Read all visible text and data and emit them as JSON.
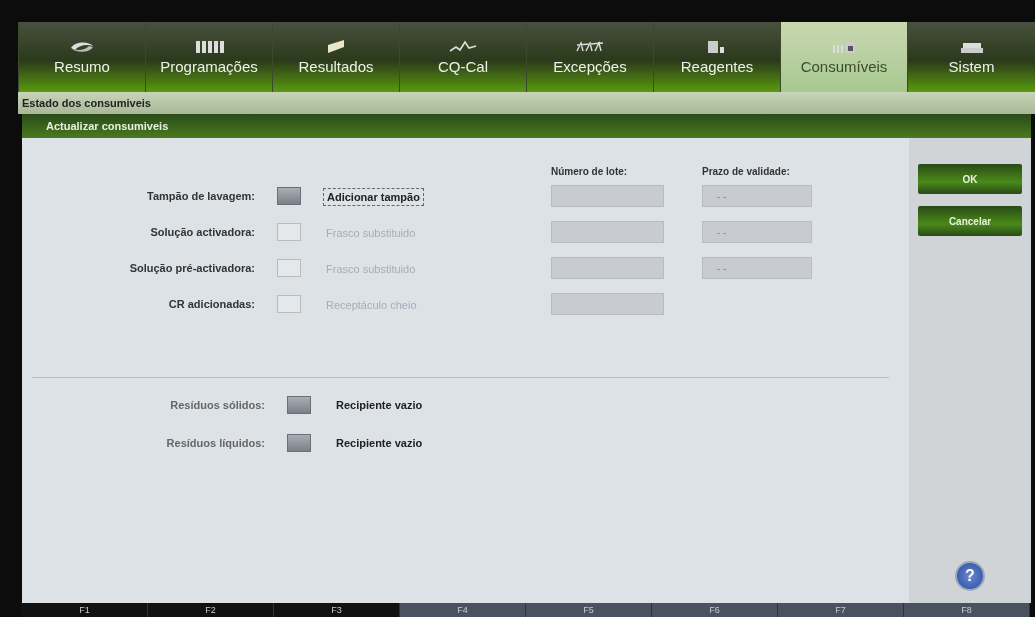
{
  "tabs": [
    {
      "label": "Resumo",
      "selected": false
    },
    {
      "label": "Programações",
      "selected": false
    },
    {
      "label": "Resultados",
      "selected": false
    },
    {
      "label": "CQ-Cal",
      "selected": false
    },
    {
      "label": "Excepções",
      "selected": false
    },
    {
      "label": "Reagentes",
      "selected": false
    },
    {
      "label": "Consumíveis",
      "selected": true
    },
    {
      "label": "Sistem",
      "selected": false
    }
  ],
  "breadcrumb": "Estado dos consumiveis",
  "dialog": {
    "title": "Actualizar consumiveis",
    "columns": [
      "Número de lote:",
      "Prazo de validade:"
    ],
    "consumables": [
      {
        "label": "Tampão de lavagem:",
        "action": "Adicionar tampão",
        "disabled": false,
        "expiry": "- -"
      },
      {
        "label": "Solução activadora:",
        "action": "Frasco substituido",
        "disabled": true,
        "expiry": "- -"
      },
      {
        "label": "Solução pré-activadora:",
        "action": "Frasco substituido",
        "disabled": true,
        "expiry": "- -"
      },
      {
        "label": "CR adicionadas:",
        "action": "Receptáculo cheio",
        "disabled": true
      }
    ],
    "waste": [
      {
        "label": "Resíduos sólidos:",
        "action": "Recipiente vazio",
        "disabled": false
      },
      {
        "label": "Resíduos líquidos:",
        "action": "Recipiente vazio",
        "disabled": false
      }
    ],
    "buttons": [
      "OK",
      "Cancelar"
    ],
    "help": "?"
  },
  "function_keys": [
    {
      "label": "F1",
      "disabled": false
    },
    {
      "label": "F2",
      "disabled": false
    },
    {
      "label": "F3",
      "disabled": false
    },
    {
      "label": "F4",
      "disabled": true
    },
    {
      "label": "F5",
      "disabled": true
    },
    {
      "label": "F6",
      "disabled": true
    },
    {
      "label": "F7",
      "disabled": true
    },
    {
      "label": "F8",
      "disabled": true
    }
  ]
}
